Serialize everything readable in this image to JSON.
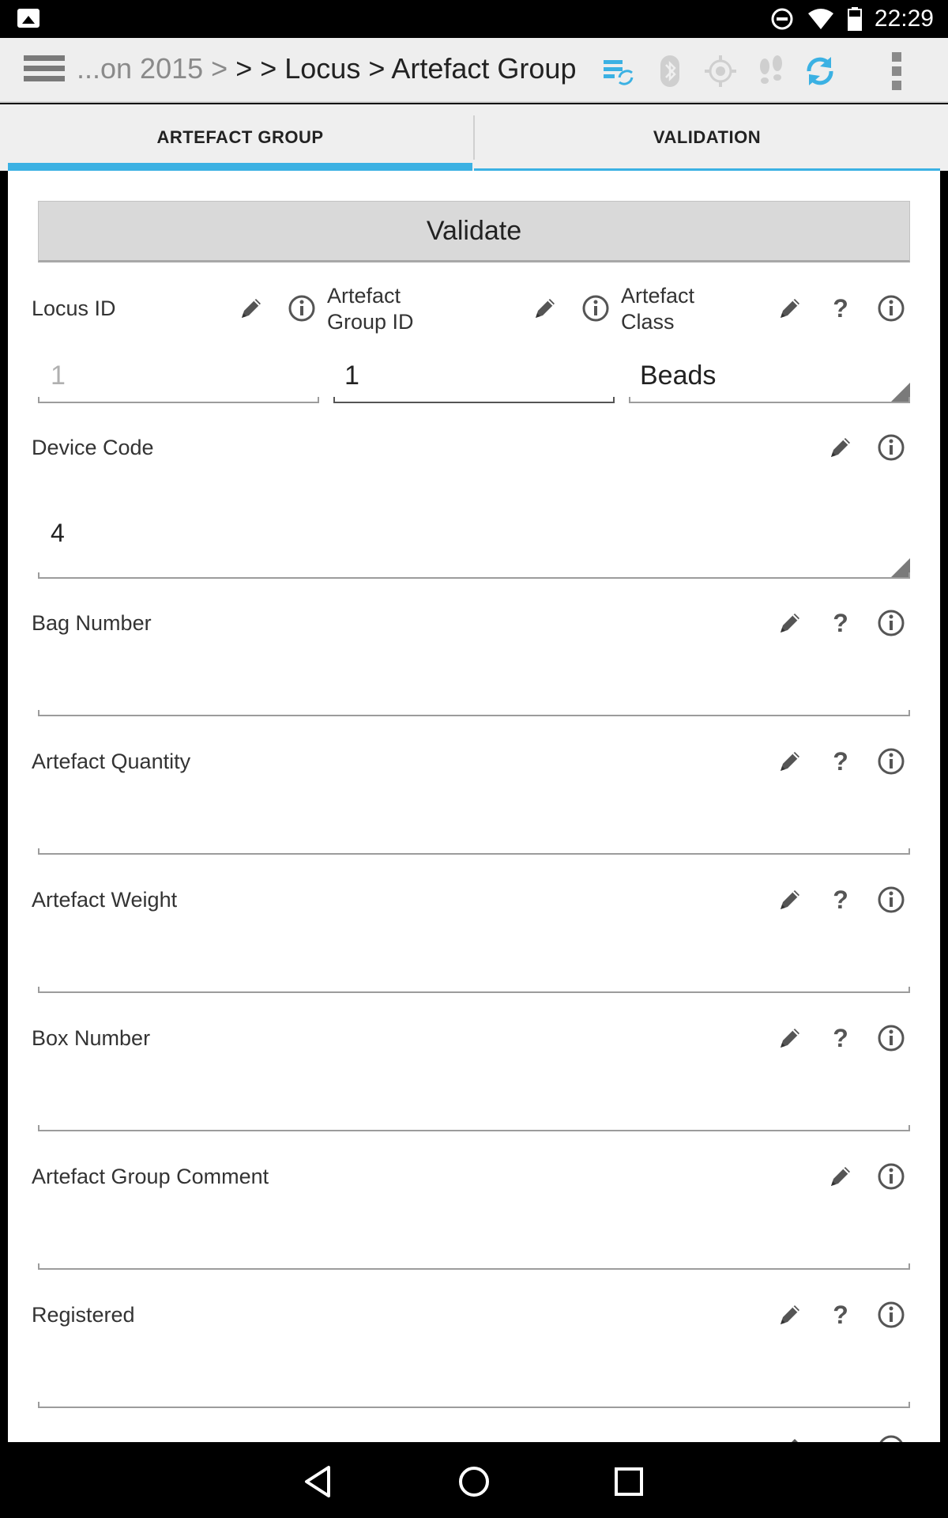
{
  "status_bar": {
    "time": "22:29",
    "icons": [
      "gallery-icon",
      "do-not-disturb-icon",
      "wifi-icon",
      "battery-icon"
    ]
  },
  "action_bar": {
    "breadcrumb_faded": "...on 2015 >",
    "breadcrumb_sep": ">",
    "breadcrumb_main": "> Locus > Artefact Group",
    "icons": [
      "menu-icon",
      "sync-status-icon",
      "bluetooth-icon",
      "gps-icon",
      "tracking-icon",
      "refresh-icon",
      "overflow-menu-icon"
    ],
    "accent_color": "#3bb1e3"
  },
  "tabs": [
    {
      "label": "ARTEFACT GROUP",
      "active": true
    },
    {
      "label": "VALIDATION",
      "active": false
    }
  ],
  "validate_label": "Validate",
  "fields": {
    "locus_id": {
      "label": "Locus ID",
      "value": "1"
    },
    "artefact_group_id": {
      "label_line1": "Artefact",
      "label_line2": "Group ID",
      "value": "1"
    },
    "artefact_class": {
      "label_line1": "Artefact",
      "label_line2": "Class",
      "value": "Beads"
    },
    "device_code": {
      "label": "Device Code",
      "value": "4"
    },
    "bag_number": {
      "label": "Bag Number",
      "value": ""
    },
    "artefact_quantity": {
      "label": "Artefact Quantity",
      "value": ""
    },
    "artefact_weight": {
      "label": "Artefact Weight",
      "value": ""
    },
    "box_number": {
      "label": "Box Number",
      "value": ""
    },
    "artefact_group_comment": {
      "label": "Artefact Group Comment",
      "value": ""
    },
    "registered": {
      "label": "Registered",
      "value": ""
    }
  },
  "help_glyph": "?"
}
